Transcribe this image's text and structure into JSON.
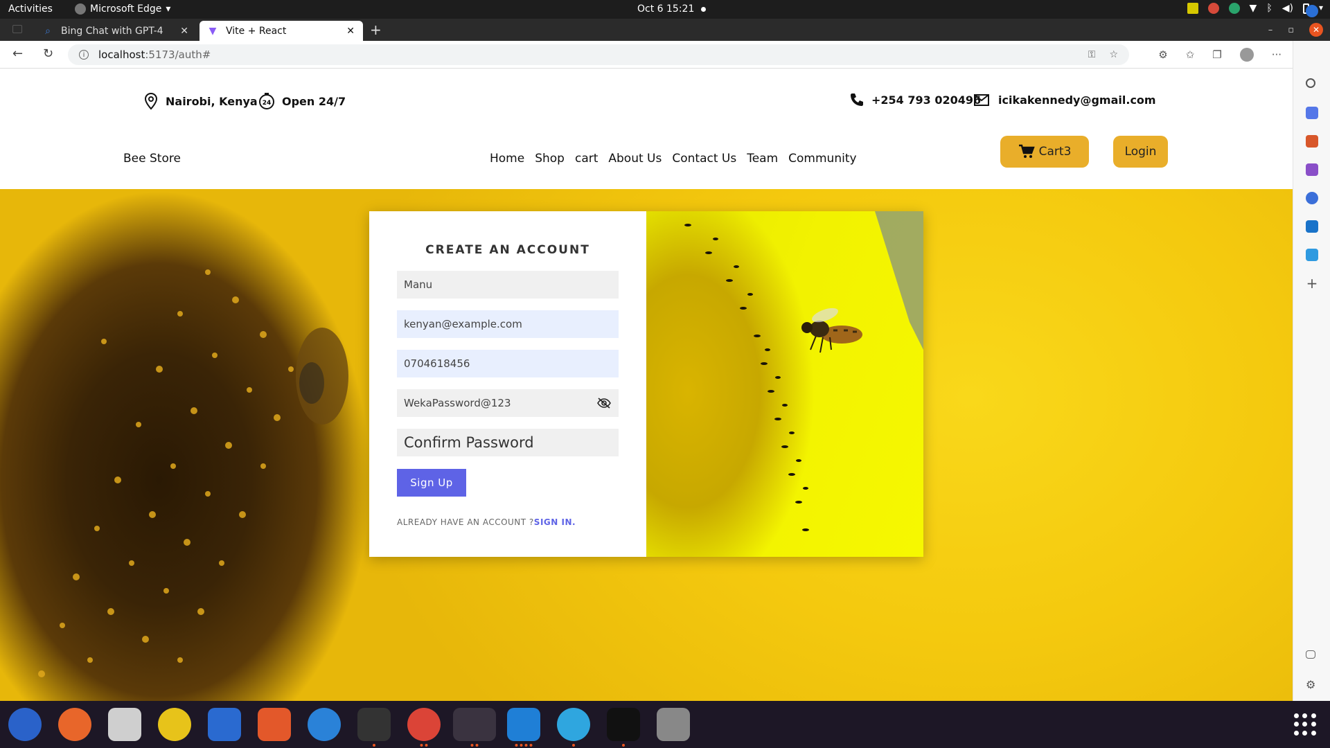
{
  "system_bar": {
    "activities": "Activities",
    "app_name": "Microsoft Edge",
    "datetime": "Oct 6  15:21"
  },
  "browser": {
    "tabs": [
      {
        "title": "Bing Chat with GPT-4",
        "active": false
      },
      {
        "title": "Vite + React",
        "active": true
      }
    ],
    "url_host": "localhost",
    "url_path": ":5173/auth#"
  },
  "site": {
    "location": "Nairobi, Kenya",
    "hours": "Open 24/7",
    "phone": "+254 793 020496",
    "email": "icikakennedy@gmail.com",
    "brand": "Bee Store",
    "nav": [
      "Home",
      "Shop",
      "cart",
      "About Us",
      "Contact Us",
      "Team",
      "Community"
    ],
    "cart_label": "Cart",
    "cart_count": "3",
    "login_label": "Login"
  },
  "form": {
    "title": "CREATE AN ACCOUNT",
    "name_value": "Manu",
    "email_value": "kenyan@example.com",
    "phone_value": "0704618456",
    "password_value": "WekaPassword@123",
    "confirm_placeholder": "Confirm Password",
    "submit_label": "Sign Up",
    "signin_prompt": "ALREADY HAVE AN ACCOUNT ?",
    "signin_link": "SIGN IN."
  },
  "colors": {
    "accent": "#5e63e6",
    "button_gold": "#e9ae2a",
    "field_blue": "#e8effe"
  }
}
